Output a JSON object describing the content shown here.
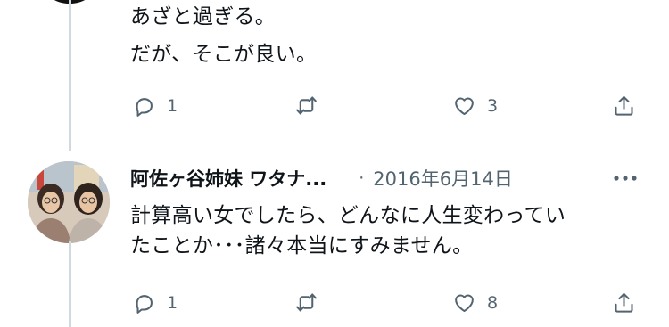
{
  "previous_tweet": {
    "text_lines": [
      "あざと過ぎる。",
      "だが、そこが良い。"
    ],
    "actions": {
      "reply_count": "1",
      "retweet_count": "",
      "like_count": "3"
    }
  },
  "reply_tweet": {
    "author_name": "阿佐ヶ谷姉妹 ワタナ...",
    "separator": "·",
    "date": "2016年6月14日",
    "text_lines": [
      "計算高い女でしたら、どんなに人生変わってい",
      "たことか･･･諸々本当にすみません。"
    ],
    "actions": {
      "reply_count": "1",
      "retweet_count": "",
      "like_count": "8"
    }
  },
  "icons": [
    "reply-icon",
    "retweet-icon",
    "like-icon",
    "share-icon",
    "more-icon"
  ],
  "colors": {
    "icon_gray": "#536471",
    "thread_line": "#cfd9de",
    "text": "#0f1419"
  }
}
